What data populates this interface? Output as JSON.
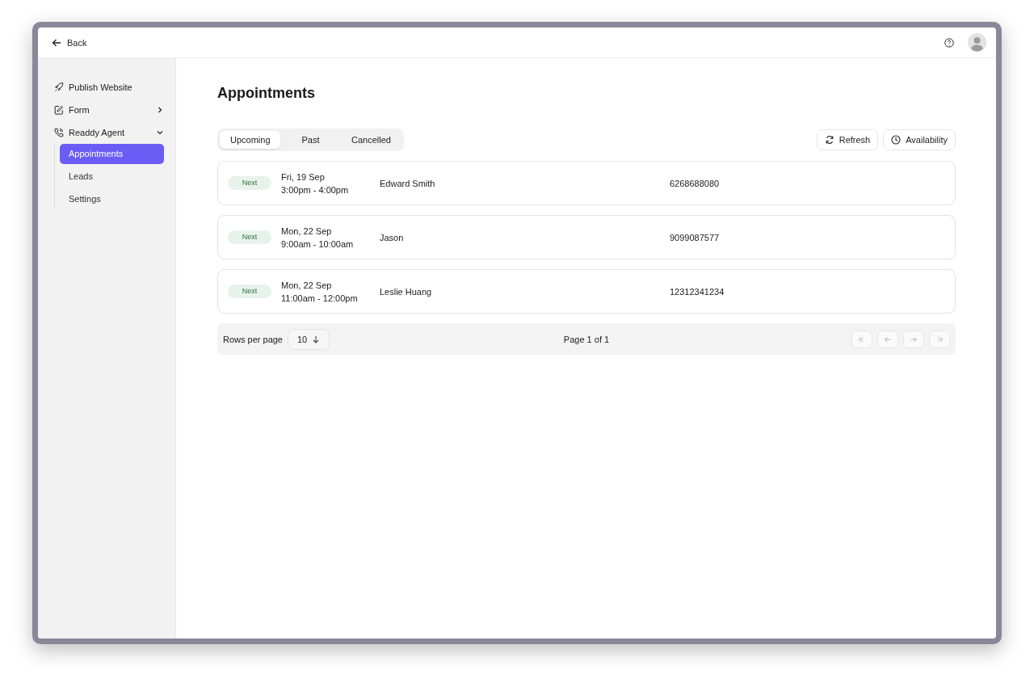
{
  "topbar": {
    "back": "Back"
  },
  "sidebar": {
    "items": [
      {
        "label": "Publish Website",
        "kind": "link"
      },
      {
        "label": "Form",
        "kind": "expandable",
        "expanded": false
      },
      {
        "label": "Readdy Agent",
        "kind": "expandable",
        "expanded": true,
        "children": [
          {
            "label": "Appointments",
            "selected": true
          },
          {
            "label": "Leads",
            "selected": false
          },
          {
            "label": "Settings",
            "selected": false
          }
        ]
      }
    ]
  },
  "page": {
    "title": "Appointments"
  },
  "tabs": [
    {
      "label": "Upcoming",
      "selected": true
    },
    {
      "label": "Past",
      "selected": false
    },
    {
      "label": "Cancelled",
      "selected": false
    }
  ],
  "actions": [
    {
      "label": "Refresh",
      "kind": "refresh"
    },
    {
      "label": "Availability",
      "kind": "availability"
    }
  ],
  "appointments": [
    {
      "badge": "Next",
      "date": "Fri, 19 Sep",
      "time": "3:00pm - 4:00pm",
      "name": "Edward Smith",
      "phone": "6268688080"
    },
    {
      "badge": "Next",
      "date": "Mon, 22 Sep",
      "time": "9:00am - 10:00am",
      "name": "Jason",
      "phone": "9099087577"
    },
    {
      "badge": "Next",
      "date": "Mon, 22 Sep",
      "time": "11:00am - 12:00pm",
      "name": "Leslie Huang",
      "phone": "12312341234"
    }
  ],
  "pagination": {
    "rows_label": "Rows per page",
    "rows_value": "10",
    "page_label": "Page 1 of 1",
    "buttons": [
      {
        "kind": "first",
        "disabled": true
      },
      {
        "kind": "prev",
        "disabled": true
      },
      {
        "kind": "next",
        "disabled": true
      },
      {
        "kind": "last",
        "disabled": true
      }
    ]
  }
}
